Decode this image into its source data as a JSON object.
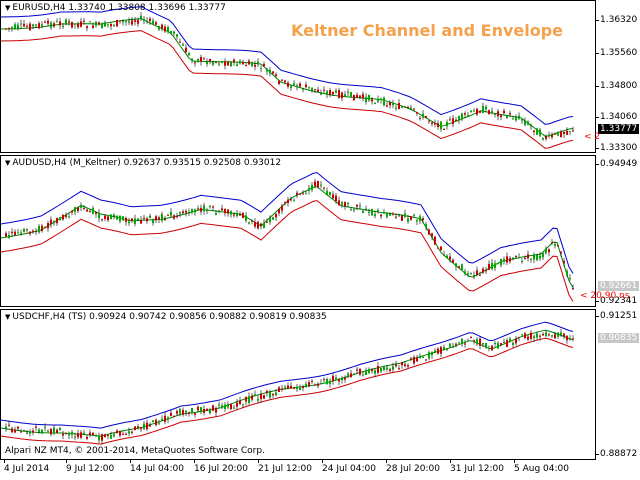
{
  "panes": [
    {
      "id": "eurusd",
      "header": "EURUSD,H4  1.33740 1.33808 1.33696 1.33777",
      "title": "Keltner Channel and Envelope",
      "ticks": [
        "1.36320",
        "1.35560",
        "1.34800",
        "1.34060",
        "1.33300"
      ],
      "price_tag": "1.33777",
      "price_tag_style": "dark",
      "red_label": "< 2",
      "colors": {
        "upper": "#0000cc",
        "middle": "#008000",
        "lower": "#cc0000"
      }
    },
    {
      "id": "audusd",
      "header": "AUDUSD,H4 (M_Keltner)  0.92637 0.93515 0.92508 0.93012",
      "ticks": [
        "0.94949",
        "0.92661",
        "0.92341"
      ],
      "price_tag": "0.92661",
      "price_tag_style": "light",
      "red_label": "< 20.90 ns",
      "colors": {
        "upper": "#0000cc",
        "middle": "#008000",
        "lower": "#cc0000"
      }
    },
    {
      "id": "usdchf",
      "header": "USDCHF,H4 (TS)  0.90924 0.90742 0.90856 0.90882 0.90819 0.90835",
      "ticks": [
        "0.91251",
        "0.90835",
        "0.88872"
      ],
      "price_tag": "0.90835",
      "price_tag_style": "light",
      "copyright": "Alpari NZ MT4, © 2001-2014, MetaQuotes Software Corp.",
      "colors": {
        "upper": "#0000cc",
        "middle": "#008000",
        "lower": "#cc0000"
      }
    }
  ],
  "x_axis": [
    "4 Jul 2014",
    "9 Jul 12:00",
    "14 Jul 04:00",
    "16 Jul 20:00",
    "21 Jul 12:00",
    "24 Jul 04:00",
    "28 Jul 20:00",
    "31 Jul 12:00",
    "5 Aug 04:00"
  ],
  "colors": {
    "bull_candle": "#00aa00",
    "bear_candle": "#cc0000",
    "title": "#f5a04a"
  }
}
